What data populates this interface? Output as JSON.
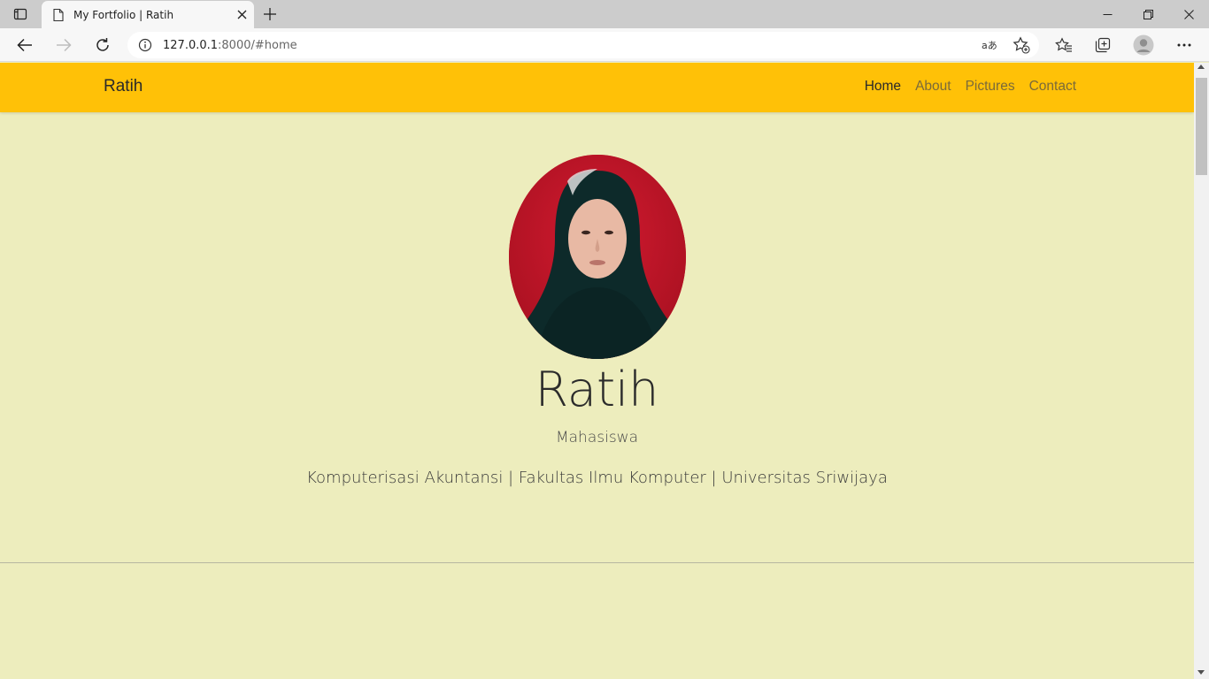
{
  "browser": {
    "tab_title": "My Fortfolio | Ratih",
    "address": {
      "host": "127.0.0.1",
      "rest": ":8000/#home"
    }
  },
  "page": {
    "navbar": {
      "brand": "Ratih",
      "links": [
        {
          "label": "Home",
          "active": true
        },
        {
          "label": "About",
          "active": false
        },
        {
          "label": "Pictures",
          "active": false
        },
        {
          "label": "Contact",
          "active": false
        }
      ],
      "bg_color": "#ffc107"
    },
    "hero": {
      "name": "Ratih",
      "role": "Mahasiswa",
      "description": "Komputerisasi Akuntansi | Fakultas Ilmu Komputer | Universitas Sriwijaya",
      "bg_color": "#ededbd",
      "avatar_bg_color": "#c8182d"
    }
  }
}
